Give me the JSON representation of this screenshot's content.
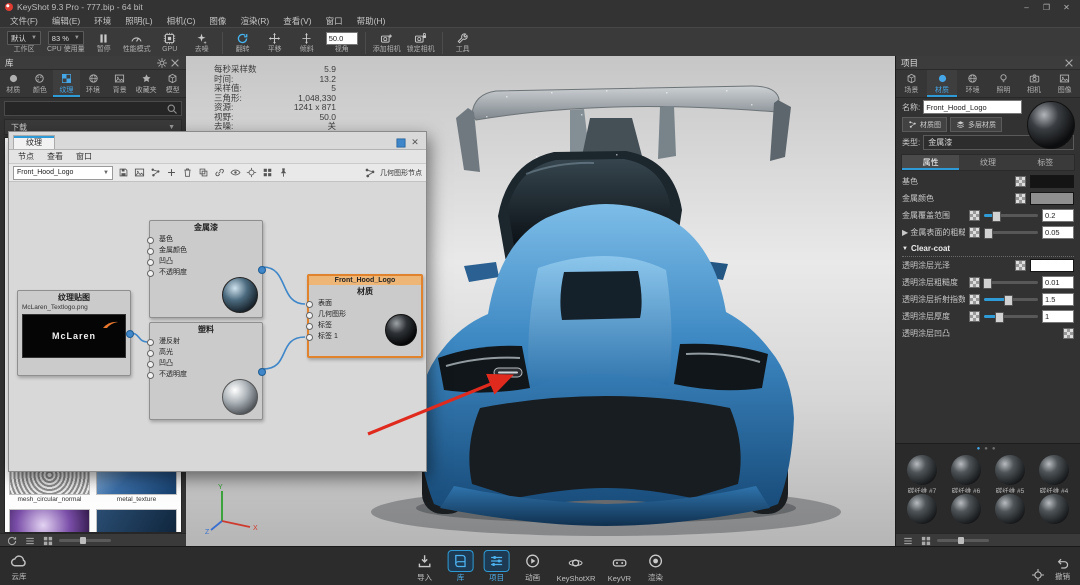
{
  "window": {
    "title": "KeyShot 9.3 Pro - 777.bip - 64 bit",
    "minimize": "–",
    "maximize": "❐",
    "close": "✕"
  },
  "menubar": [
    {
      "name": "file",
      "label": "文件(F)"
    },
    {
      "name": "edit",
      "label": "编辑(E)"
    },
    {
      "name": "environment",
      "label": "环境"
    },
    {
      "name": "lighting",
      "label": "照明(L)"
    },
    {
      "name": "camera",
      "label": "相机(C)"
    },
    {
      "name": "image",
      "label": "图像"
    },
    {
      "name": "render",
      "label": "渲染(R)"
    },
    {
      "name": "view",
      "label": "查看(V)"
    },
    {
      "name": "window",
      "label": "窗口"
    },
    {
      "name": "help",
      "label": "帮助(H)"
    }
  ],
  "toolbar": {
    "items": [
      {
        "type": "select",
        "name": "workspace",
        "value": "默认",
        "label": "工作区"
      },
      {
        "type": "select",
        "name": "cpu-usage",
        "value": "83 %",
        "label": "CPU 使用量"
      },
      {
        "type": "icon",
        "name": "pause",
        "icon": "pause",
        "label": "暂停"
      },
      {
        "type": "icon",
        "name": "performance-mode",
        "icon": "gauge",
        "label": "性能模式"
      },
      {
        "type": "icon",
        "name": "gpu",
        "icon": "chip",
        "label": "GPU"
      },
      {
        "type": "icon",
        "name": "denoise",
        "icon": "sparkle",
        "label": "去噪"
      },
      {
        "type": "sep"
      },
      {
        "type": "icon",
        "name": "tumble",
        "icon": "rotate",
        "label": "翻转",
        "accent": true
      },
      {
        "type": "icon",
        "name": "pan",
        "icon": "pan",
        "label": "平移"
      },
      {
        "type": "icon",
        "name": "dolly",
        "icon": "dolly",
        "label": "倾斜"
      },
      {
        "type": "value",
        "name": "fov",
        "value": "50.0",
        "label": "视角"
      },
      {
        "type": "sep"
      },
      {
        "type": "icon",
        "name": "add-camera",
        "icon": "camera-plus",
        "label": "添加相机"
      },
      {
        "type": "icon",
        "name": "lock-camera",
        "icon": "camera-lock",
        "label": "锁定相机"
      },
      {
        "type": "sep"
      },
      {
        "type": "icon",
        "name": "tools",
        "icon": "wrench",
        "label": "工具"
      }
    ]
  },
  "stats": [
    {
      "label": "每秒采样数",
      "value": "5.9"
    },
    {
      "label": "时间:",
      "value": "13.2"
    },
    {
      "label": "采样值:",
      "value": "5"
    },
    {
      "label": "三角形:",
      "value": "1,048,330"
    },
    {
      "label": "资源:",
      "value": "1241 x 871"
    },
    {
      "label": "视野:",
      "value": "50.0"
    },
    {
      "label": "去噪:",
      "value": "关"
    }
  ],
  "viewport": {
    "annotation": {
      "color": "#e02a1e"
    },
    "axis": {
      "x": "X",
      "y": "Y",
      "z": "Z"
    }
  },
  "library": {
    "title": "库",
    "header_icons": [
      {
        "name": "gear"
      },
      {
        "name": "close"
      }
    ],
    "tabs": [
      {
        "name": "materials",
        "label": "材质",
        "icon": "sphere"
      },
      {
        "name": "colors",
        "label": "颜色",
        "icon": "palette"
      },
      {
        "name": "textures",
        "label": "纹理",
        "icon": "checker",
        "active": true
      },
      {
        "name": "environments",
        "label": "环境",
        "icon": "globe"
      },
      {
        "name": "backplates",
        "label": "背景",
        "icon": "image"
      },
      {
        "name": "favorites",
        "label": "收藏夹",
        "icon": "star"
      },
      {
        "name": "models",
        "label": "模型",
        "icon": "cube"
      }
    ],
    "search": {
      "placeholder": "",
      "icon": "search"
    },
    "tree": {
      "label": "下载"
    },
    "thumbnails": [
      {
        "label": "mesh_circular_normal",
        "pattern": "pat-mesh-gray"
      },
      {
        "label": "metal_texture",
        "pattern": "pat-metal-blue"
      },
      {
        "label": "",
        "pattern": "pat-purple-fractal"
      },
      {
        "label": "",
        "pattern": "pat-dark-blue"
      }
    ],
    "footer_icons": [
      {
        "name": "refresh"
      },
      {
        "name": "list"
      },
      {
        "name": "grid"
      }
    ]
  },
  "graph_window": {
    "tab": "纹理",
    "menus": [
      {
        "name": "node",
        "label": "节点"
      },
      {
        "name": "view",
        "label": "查看"
      },
      {
        "name": "window",
        "label": "窗口"
      }
    ],
    "material_select": "Front_Hood_Logo",
    "toolbar_icons": [
      "save",
      "image",
      "nodes",
      "plus",
      "trash",
      "duplicate",
      "link",
      "eye",
      "crosshair",
      "grid",
      "pin"
    ],
    "geometry_toggle": {
      "icon": "nodes",
      "label": "几何图形节点"
    },
    "close": "✕",
    "nodes": {
      "texture": {
        "type_label": "纹理贴图",
        "file": "McLaren_Textlogo.png",
        "thumb_text": "McLaren"
      },
      "paint": {
        "title": "金属漆",
        "ports": [
          {
            "label": "基色"
          },
          {
            "label": "金属颜色"
          },
          {
            "label": "凹凸"
          },
          {
            "label": "不透明度"
          }
        ]
      },
      "plastic": {
        "title": "塑料",
        "ports": [
          {
            "label": "漫反射"
          },
          {
            "label": "高光"
          },
          {
            "label": "凹凸"
          },
          {
            "label": "不透明度"
          }
        ]
      },
      "material": {
        "name": "Front_Hood_Logo",
        "type_label": "材质",
        "ports": [
          {
            "label": "表面"
          },
          {
            "label": "几何图形"
          },
          {
            "label": "标签"
          },
          {
            "label": "标签 1"
          }
        ]
      }
    }
  },
  "project": {
    "title": "项目",
    "close": "✕",
    "tabs": [
      {
        "name": "scene",
        "label": "场景",
        "icon": "cube"
      },
      {
        "name": "material",
        "label": "材质",
        "icon": "sphere",
        "active": true
      },
      {
        "name": "environment",
        "label": "环境",
        "icon": "globe"
      },
      {
        "name": "lighting",
        "label": "照明",
        "icon": "bulb"
      },
      {
        "name": "camera",
        "label": "相机",
        "icon": "camera"
      },
      {
        "name": "image",
        "label": "图像",
        "icon": "image"
      }
    ],
    "name_label": "名称:",
    "name_value": "Front_Hood_Logo",
    "buttons": [
      {
        "name": "material-graph",
        "label": "材质图",
        "icon": "nodes"
      },
      {
        "name": "multi-material",
        "label": "多层材质",
        "icon": "layers"
      }
    ],
    "type_label": "类型:",
    "type_value": "金属漆",
    "subtabs": [
      {
        "name": "properties",
        "label": "属性",
        "active": true
      },
      {
        "name": "textures",
        "label": "纹理"
      },
      {
        "name": "labels",
        "label": "标签"
      }
    ],
    "properties": [
      {
        "kind": "color",
        "name": "base-color",
        "label": "基色",
        "swatch": "#141414"
      },
      {
        "kind": "color",
        "name": "metal-color",
        "label": "金属颜色",
        "swatch": "#8f8f8f"
      },
      {
        "kind": "slider",
        "name": "metal-coverage",
        "label": "金属覆盖范围",
        "value": "0.2",
        "pct": 20
      },
      {
        "kind": "slider",
        "name": "metal-roughness",
        "label": "金属表面的粗糙度",
        "value": "0.05",
        "pct": 6,
        "expandable": true
      },
      {
        "kind": "section",
        "name": "clearcoat-section",
        "label": "Clear-coat"
      },
      {
        "kind": "color",
        "name": "clearcoat-gloss",
        "label": "透明涂层光泽",
        "swatch": "#ffffff"
      },
      {
        "kind": "slider",
        "name": "clearcoat-roughness",
        "label": "透明涂层粗糙度",
        "value": "0.01",
        "pct": 3
      },
      {
        "kind": "slider",
        "name": "clearcoat-ior",
        "label": "透明涂层折射指数",
        "value": "1.5",
        "pct": 42
      },
      {
        "kind": "slider",
        "name": "clearcoat-thickness",
        "label": "透明涂层厚度",
        "value": "1",
        "pct": 25
      },
      {
        "kind": "map",
        "name": "clearcoat-bump",
        "label": "透明涂层凹凸"
      }
    ],
    "materials": {
      "pager_dots": 3,
      "accent": "#45a7e8",
      "items": [
        {
          "label": "碳纤维 #7"
        },
        {
          "label": "碳纤维 #6"
        },
        {
          "label": "碳纤维 #5"
        },
        {
          "label": "碳纤维 #4"
        },
        {
          "label": ""
        },
        {
          "label": ""
        },
        {
          "label": ""
        },
        {
          "label": ""
        }
      ]
    },
    "footer_icons": [
      {
        "name": "list"
      },
      {
        "name": "grid"
      }
    ]
  },
  "dock": {
    "cloud": {
      "name": "cloud-library",
      "label": "云库",
      "icon": "cloud"
    },
    "items": [
      {
        "name": "import",
        "label": "导入",
        "icon": "import"
      },
      {
        "name": "library",
        "label": "库",
        "icon": "book",
        "active": true
      },
      {
        "name": "project",
        "label": "项目",
        "icon": "sliders",
        "active": true
      },
      {
        "name": "animation",
        "label": "动画",
        "icon": "play"
      },
      {
        "name": "keyshotxr",
        "label": "KeyShotXR",
        "icon": "orbit"
      },
      {
        "name": "keyvr",
        "label": "KeyVR",
        "icon": "vr"
      },
      {
        "name": "render",
        "label": "渲染",
        "icon": "aperture"
      }
    ],
    "right": [
      {
        "name": "locate",
        "label": "",
        "icon": "crosshair"
      },
      {
        "name": "undo",
        "label": "撤销",
        "icon": "undo"
      }
    ]
  }
}
